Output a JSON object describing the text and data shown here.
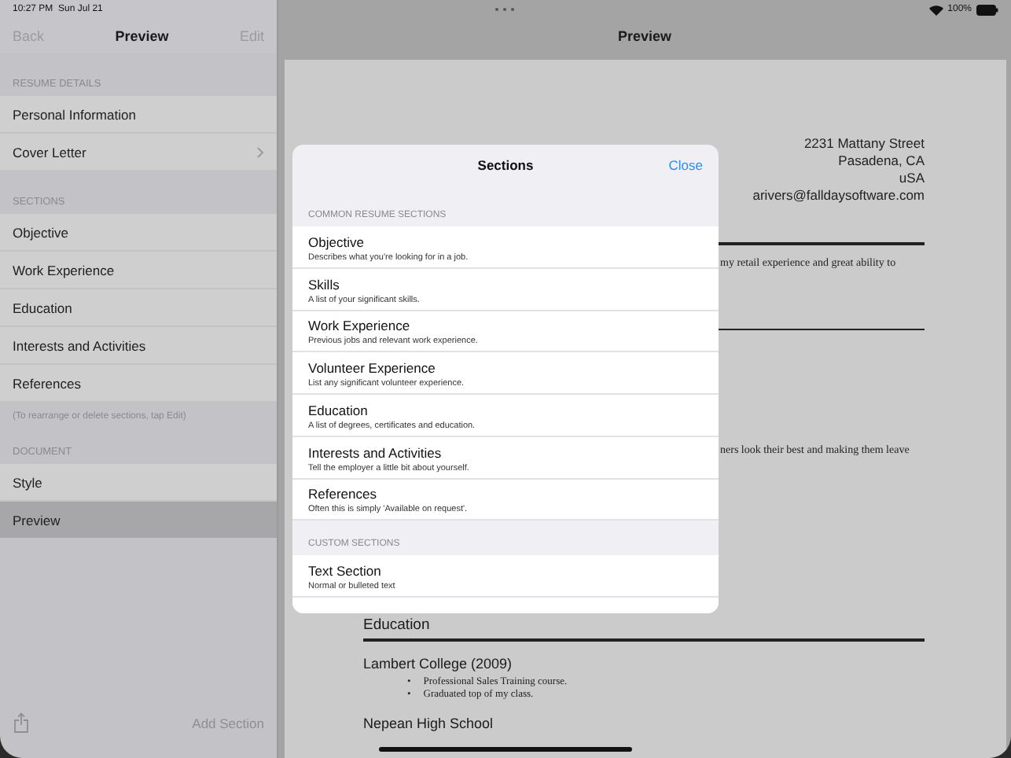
{
  "status_bar": {
    "time": "10:27 PM",
    "date": "Sun Jul 21",
    "battery": "100%"
  },
  "sidebar": {
    "back": "Back",
    "title": "Preview",
    "edit": "Edit",
    "groups": [
      {
        "header": "RESUME DETAILS",
        "items": [
          {
            "label": "Personal Information",
            "disclosure": false,
            "selected": false
          },
          {
            "label": "Cover Letter",
            "disclosure": true,
            "selected": false
          }
        ]
      },
      {
        "header": "SECTIONS",
        "items": [
          {
            "label": "Objective",
            "disclosure": false,
            "selected": false
          },
          {
            "label": "Work Experience",
            "disclosure": false,
            "selected": false
          },
          {
            "label": "Education",
            "disclosure": false,
            "selected": false
          },
          {
            "label": "Interests and Activities",
            "disclosure": false,
            "selected": false
          },
          {
            "label": "References",
            "disclosure": false,
            "selected": false
          }
        ],
        "footer": "(To rearrange or delete sections, tap Edit)"
      },
      {
        "header": "DOCUMENT",
        "items": [
          {
            "label": "Style",
            "disclosure": false,
            "selected": false
          },
          {
            "label": "Preview",
            "disclosure": false,
            "selected": true
          }
        ]
      }
    ],
    "add_section": "Add Section"
  },
  "preview": {
    "title": "Preview",
    "address": [
      "2231 Mattany Street",
      "Pasadena, CA",
      "uSA",
      "arivers@falldaysoftware.com"
    ],
    "objective_fragment": "my retail experience and great ability to",
    "experience_fragment": "ners look their best and making them leave",
    "education_heading": "Education",
    "schools": [
      {
        "name": "Lambert College (2009)",
        "marker": "•",
        "bullets": [
          "Professional Sales Training course.",
          "Graduated top of my class."
        ]
      },
      {
        "name": "Nepean High School"
      }
    ]
  },
  "sheet": {
    "title": "Sections",
    "close": "Close",
    "groups": [
      {
        "header": "COMMON RESUME SECTIONS",
        "items": [
          {
            "title": "Objective",
            "subtitle": "Describes what you're looking for in a job."
          },
          {
            "title": "Skills",
            "subtitle": "A list of your significant skills."
          },
          {
            "title": "Work Experience",
            "subtitle": "Previous jobs and relevant work experience."
          },
          {
            "title": "Volunteer Experience",
            "subtitle": "List any significant volunteer experience."
          },
          {
            "title": "Education",
            "subtitle": "A list of degrees, certificates and education."
          },
          {
            "title": "Interests and Activities",
            "subtitle": "Tell the employer a little bit about yourself."
          },
          {
            "title": "References",
            "subtitle": "Often this is simply 'Available on request'."
          }
        ]
      },
      {
        "header": "CUSTOM SECTIONS",
        "items": [
          {
            "title": "Text Section",
            "subtitle": "Normal or bulleted text"
          }
        ]
      }
    ]
  }
}
